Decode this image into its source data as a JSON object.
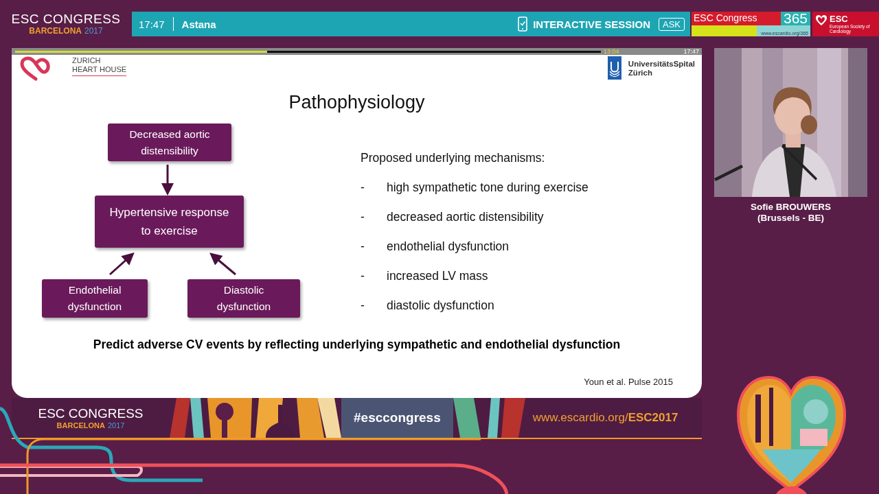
{
  "header": {
    "logo": {
      "title": "ESC CONGRESS",
      "city": "BARCELONA",
      "year": "2017"
    },
    "time": "17:47",
    "room": "Astana",
    "session": "INTERACTIVE SESSION",
    "ask": "ASK",
    "brand": {
      "name": "ESC Congress",
      "number": "365",
      "url": "www.escardio.org/365"
    },
    "society": {
      "abbr": "ESC",
      "name": "European Society of Cardiology"
    }
  },
  "player": {
    "level": 0.43,
    "elapsed": "13:04",
    "clock": "17:47"
  },
  "slide": {
    "logo_left": [
      "ZURICH",
      "HEART HOUSE"
    ],
    "logo_right": [
      "UniversitätsSpital",
      "Zürich"
    ],
    "title": "Pathophysiology",
    "diagram": {
      "top": "Decreased aortic distensibility",
      "middle": "Hypertensive response to exercise",
      "left": "Endothelial dysfunction",
      "right": "Diastolic dysfunction"
    },
    "mechanisms": {
      "heading": "Proposed underlying mechanisms:",
      "items": [
        {
          "bullet": "-",
          "text": "high sympathetic tone during exercise"
        },
        {
          "bullet": "-",
          "text": "decreased aortic distensibility"
        },
        {
          "bullet": "-",
          "text": "endothelial dysfunction"
        },
        {
          "bullet": "-",
          "text": "increased LV mass"
        },
        {
          "bullet": "-",
          "text": "diastolic dysfunction"
        }
      ]
    },
    "conclusion": "Predict adverse CV events by reflecting underlying sympathetic and endothelial dysfunction",
    "citation": "Youn et al. Pulse 2015"
  },
  "speaker": {
    "name": "Sofie BROUWERS",
    "origin": "(Brussels - BE)"
  },
  "banner": {
    "logo": {
      "title": "ESC CONGRESS",
      "city": "BARCELONA",
      "year": "2017"
    },
    "hashtag": "#esccongress",
    "url": "www.escardio.org/",
    "url_bold": "ESC2017"
  }
}
